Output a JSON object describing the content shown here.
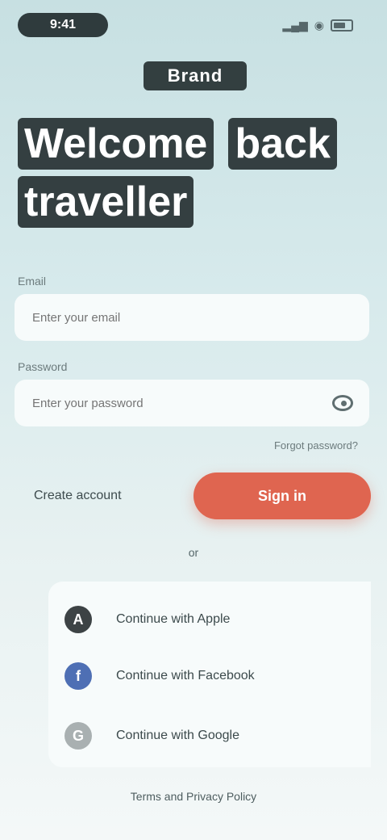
{
  "status_bar": {
    "time": "9:41",
    "signal": "▂▄▆",
    "wifi": "◉",
    "battery": ""
  },
  "brand": "Brand",
  "headline": {
    "line1_word1": "Welcome",
    "line1_word2": "back",
    "line2": "traveller"
  },
  "form": {
    "email_label": "Email",
    "email_placeholder": "Enter your email",
    "password_label": "Password",
    "password_placeholder": "Enter your password",
    "forgot": "Forgot password?"
  },
  "actions": {
    "create_account": "Create account",
    "sign_in": "Sign in"
  },
  "divider": "or",
  "socials": [
    {
      "label": "Continue with Apple",
      "logo": "A",
      "icon": "apple-icon"
    },
    {
      "label": "Continue with Facebook",
      "logo": "f",
      "icon": "facebook-icon"
    },
    {
      "label": "Continue with Google",
      "logo": "G",
      "icon": "google-icon"
    }
  ],
  "footer": "Terms and Privacy Policy"
}
